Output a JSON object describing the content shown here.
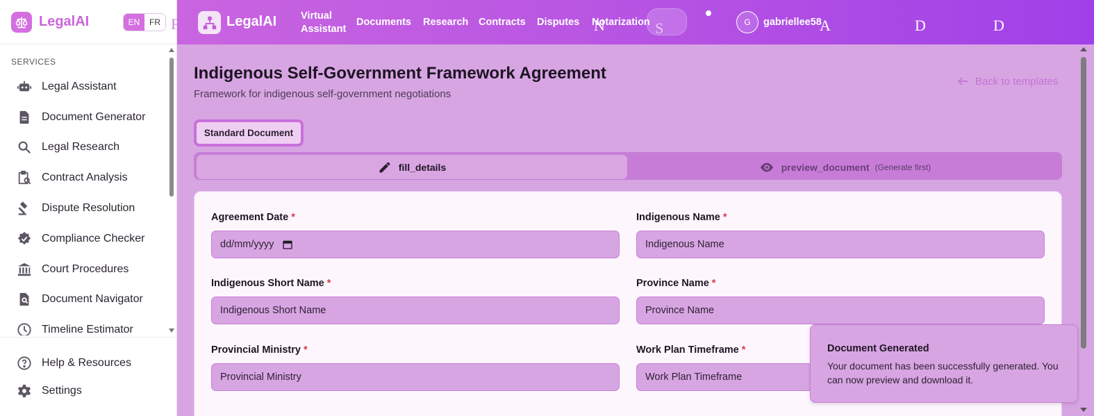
{
  "sidebar": {
    "brand": "LegalAI",
    "lang": {
      "en": "EN",
      "fr": "FR"
    },
    "stray_glyph": "F",
    "section_title": "SERVICES",
    "items": [
      {
        "label": "Legal Assistant",
        "icon": "robot-icon"
      },
      {
        "label": "Document Generator",
        "icon": "document-icon"
      },
      {
        "label": "Legal Research",
        "icon": "search-icon"
      },
      {
        "label": "Contract Analysis",
        "icon": "clipboard-search-icon"
      },
      {
        "label": "Dispute Resolution",
        "icon": "gavel-icon"
      },
      {
        "label": "Compliance Checker",
        "icon": "verified-badge-icon"
      },
      {
        "label": "Court Procedures",
        "icon": "courthouse-icon"
      },
      {
        "label": "Document Navigator",
        "icon": "document-search-icon"
      },
      {
        "label": "Timeline Estimator",
        "icon": "clock-icon"
      }
    ],
    "bottom": [
      {
        "label": "Help & Resources",
        "icon": "help-circle-icon"
      },
      {
        "label": "Settings",
        "icon": "gear-icon"
      }
    ]
  },
  "topnav": {
    "brand": "LegalAI",
    "items": {
      "virtual_line1": "Virtual",
      "virtual_line2": "Assistant",
      "documents": "Documents",
      "research": "Research",
      "contracts": "Contracts",
      "disputes": "Disputes",
      "notarization": "Notarization"
    },
    "glyphs": {
      "n": "N",
      "s": "S",
      "a": "A",
      "d1": "D",
      "d2": "D"
    },
    "avatar_initial": "G",
    "username": "gabriellee58"
  },
  "page": {
    "title": "Indigenous Self-Government Framework Agreement",
    "subtitle": "Framework for indigenous self-government negotiations",
    "back_link": "Back to templates",
    "standard_button": "Standard Document"
  },
  "tabs": {
    "fill": "fill_details",
    "preview": "preview_document",
    "preview_hint": "(Generate first)"
  },
  "form": {
    "agreement_date": {
      "label": "Agreement Date",
      "placeholder": "dd/mm/yyyy"
    },
    "indigenous_name": {
      "label": "Indigenous Name",
      "placeholder": "Indigenous Name"
    },
    "indigenous_short_name": {
      "label": "Indigenous Short Name",
      "placeholder": "Indigenous Short Name"
    },
    "province_name": {
      "label": "Province Name",
      "placeholder": "Province Name"
    },
    "provincial_ministry": {
      "label": "Provincial Ministry",
      "placeholder": "Provincial Ministry"
    },
    "work_plan_timeframe": {
      "label": "Work Plan Timeframe",
      "placeholder": "Work Plan Timeframe"
    },
    "required_mark": "*"
  },
  "toast": {
    "title": "Document Generated",
    "body": "Your document has been successfully generated. You can now preview and download it."
  },
  "colors": {
    "accent": "#c966d9",
    "background": "#d8a5e3",
    "nav_gradient_start": "#c965e0",
    "nav_gradient_end": "#a040e8",
    "required": "#d83a4f"
  }
}
